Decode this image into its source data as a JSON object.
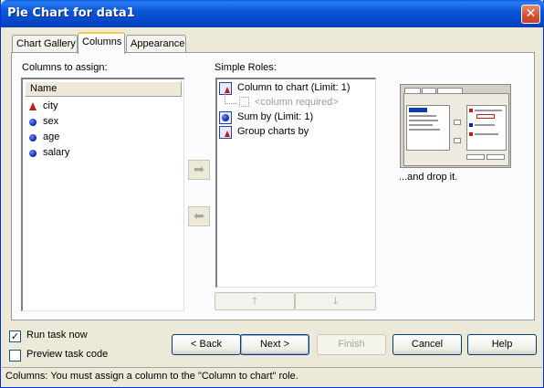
{
  "window": {
    "title": "Pie Chart for data1",
    "close": "✕"
  },
  "tabs": [
    {
      "label": "Chart Gallery"
    },
    {
      "label": "Columns",
      "active": true
    },
    {
      "label": "Appearance"
    }
  ],
  "columns_panel": {
    "label": "Columns to assign:",
    "header": "Name",
    "items": [
      {
        "label": "city",
        "icon": "character-column-icon"
      },
      {
        "label": "sex",
        "icon": "numeric-column-icon"
      },
      {
        "label": "age",
        "icon": "numeric-column-icon"
      },
      {
        "label": "salary",
        "icon": "numeric-column-icon"
      }
    ]
  },
  "roles_panel": {
    "label": "Simple Roles:",
    "roles": [
      {
        "label": "Column to chart  (Limit: 1)",
        "placeholder": "<column required>"
      },
      {
        "label": "Sum by  (Limit: 1)"
      },
      {
        "label": "Group charts by"
      }
    ]
  },
  "arrows": {
    "add": "➡",
    "remove": "⬅",
    "up": "🡑",
    "down": "🡓"
  },
  "preview": {
    "caption": "...and drop it."
  },
  "options": {
    "run_task_now": {
      "label": "Run task now",
      "checked": true,
      "mark": "✓"
    },
    "preview_task_code": {
      "label": "Preview task code",
      "checked": false
    }
  },
  "buttons": {
    "back": "< Back",
    "next": "Next >",
    "finish": "Finish",
    "cancel": "Cancel",
    "help": "Help"
  },
  "status": "Columns: You must assign a column to the \"Column to chart\" role."
}
